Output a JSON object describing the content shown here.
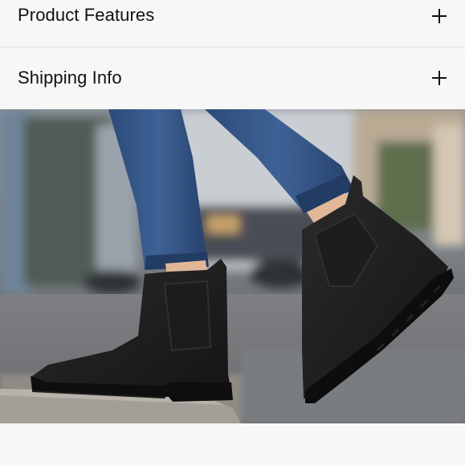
{
  "accordion": {
    "items": [
      {
        "label": "Product Features",
        "icon": "plus-icon"
      },
      {
        "label": "Shipping Info",
        "icon": "plus-icon"
      }
    ]
  },
  "hero": {
    "image": "product-photo-black-chelsea-boots"
  },
  "colors": {
    "background": "#f7f7f7",
    "text": "#111111",
    "divider": "#dcdcdc"
  }
}
